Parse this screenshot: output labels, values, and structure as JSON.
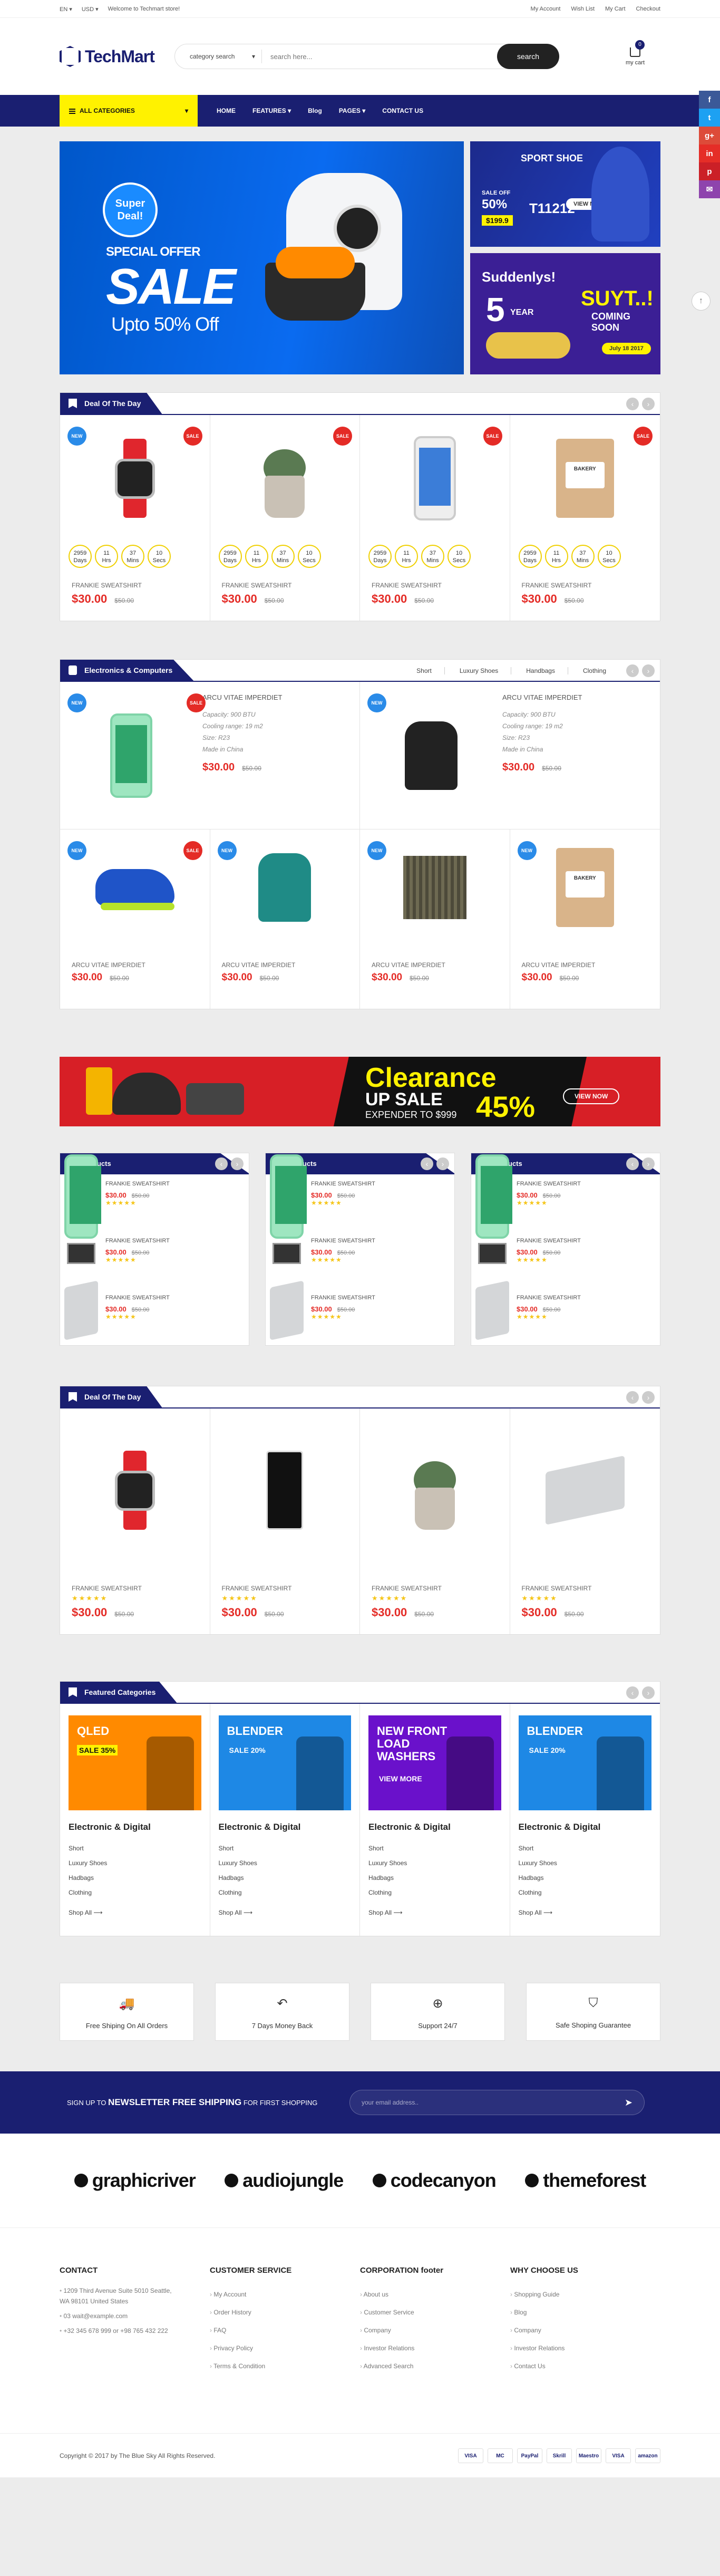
{
  "topbar": {
    "lang": "EN",
    "currency": "USD",
    "welcome": "Welcome to Techmart store!",
    "links": [
      "My Account",
      "Wish List",
      "My Cart",
      "Checkout"
    ]
  },
  "header": {
    "logo": "TechMart",
    "category_select": "category search",
    "search_placeholder": "search here...",
    "search_button": "search",
    "cart_label": "my cart",
    "cart_count": "0"
  },
  "nav": {
    "all_categories": "ALL CATEGORIES",
    "links": [
      "HOME",
      "FEATURES",
      "Blog",
      "PAGES",
      "CONTACT US"
    ]
  },
  "social": [
    {
      "icon": "facebook-icon",
      "glyph": "f",
      "color": "#3b5998"
    },
    {
      "icon": "twitter-icon",
      "glyph": "t",
      "color": "#1da1f2"
    },
    {
      "icon": "google-plus-icon",
      "glyph": "g+",
      "color": "#dd4b39"
    },
    {
      "icon": "linkedin-icon",
      "glyph": "in",
      "color": "#e52d27"
    },
    {
      "icon": "pinterest-icon",
      "glyph": "p",
      "color": "#cb2027"
    },
    {
      "icon": "email-icon",
      "glyph": "✉",
      "color": "#8e44ad"
    }
  ],
  "hero": {
    "badge": "Super Deal!",
    "special": "SPECIAL OFFER",
    "sale": "SALE",
    "upto": "Upto 50% Off",
    "side1": {
      "title": "SPORT SHOE",
      "sale_label": "SALE OFF",
      "pct": "50%",
      "price": "$199.9",
      "model": "T11212",
      "view": "VIEW NOW"
    },
    "side2": {
      "title": "Suddenlys!",
      "year": "YEAR",
      "big": "SUYT..!",
      "coming": "COMING SOON",
      "date": "July 18 2017"
    }
  },
  "deal1": {
    "title": "Deal Of The Day",
    "products": [
      {
        "img": "watch",
        "new": true,
        "sale": true,
        "name": "FRANKIE SWEATSHIRT",
        "price": "$30.00",
        "old": "$50.00",
        "countdown": [
          "2959",
          "11",
          "37",
          "10"
        ]
      },
      {
        "img": "plant",
        "new": false,
        "sale": true,
        "name": "FRANKIE SWEATSHIRT",
        "price": "$30.00",
        "old": "$50.00",
        "countdown": [
          "2959",
          "11",
          "37",
          "10"
        ]
      },
      {
        "img": "phone",
        "new": false,
        "sale": true,
        "name": "FRANKIE SWEATSHIRT",
        "price": "$30.00",
        "old": "$50.00",
        "countdown": [
          "2959",
          "11",
          "37",
          "10"
        ]
      },
      {
        "img": "bag",
        "new": false,
        "sale": true,
        "name": "FRANKIE SWEATSHIRT",
        "price": "$30.00",
        "old": "$50.00",
        "countdown": [
          "2959",
          "11",
          "37",
          "10"
        ]
      }
    ],
    "count_units": [
      "Days",
      "Hrs",
      "Mins",
      "Secs"
    ]
  },
  "electronics": {
    "title": "Electronics & Computers",
    "tabs": [
      "Short",
      "Luxury Shoes",
      "Handbags",
      "Clothing"
    ],
    "feature": [
      {
        "img": "phone-green",
        "name": "ARCU VITAE IMPERDIET",
        "specs": [
          "Capacity: 900 BTU",
          "Cooling range: 19 m2",
          "Size: R23",
          "Made in China"
        ],
        "price": "$30.00",
        "old": "$50.00"
      },
      {
        "img": "backpack",
        "name": "ARCU VITAE IMPERDIET",
        "specs": [
          "Capacity: 900 BTU",
          "Cooling range: 19 m2",
          "Size: R23",
          "Made in China"
        ],
        "price": "$30.00",
        "old": "$50.00"
      }
    ],
    "small": [
      {
        "img": "shoe",
        "new": true,
        "sale": true,
        "name": "ARCU VITAE IMPERDIET",
        "price": "$30.00",
        "old": "$50.00"
      },
      {
        "img": "backpack-teal",
        "new": true,
        "sale": false,
        "name": "ARCU VITAE IMPERDIET",
        "price": "$30.00",
        "old": "$50.00"
      },
      {
        "img": "scarf",
        "new": true,
        "sale": false,
        "name": "ARCU VITAE IMPERDIET",
        "price": "$30.00",
        "old": "$50.00"
      },
      {
        "img": "bag",
        "new": true,
        "sale": false,
        "name": "ARCU VITAE IMPERDIET",
        "price": "$30.00",
        "old": "$50.00"
      }
    ]
  },
  "clearance": {
    "t1": "Clearance",
    "t2": "UP SALE",
    "t3": "45%",
    "t4": "EXPENDER TO $999",
    "btn": "VIEW NOW"
  },
  "new_products": {
    "title": "New Products",
    "items": [
      {
        "img": "phone-green",
        "name": "FRANKIE SWEATSHIRT",
        "price": "$30.00",
        "old": "$50.00"
      },
      {
        "img": "monitor",
        "name": "FRANKIE SWEATSHIRT",
        "price": "$30.00",
        "old": "$50.00"
      },
      {
        "img": "laptop",
        "name": "FRANKIE SWEATSHIRT",
        "price": "$30.00",
        "old": "$50.00"
      }
    ]
  },
  "deal2": {
    "title": "Deal Of The Day",
    "products": [
      {
        "img": "watch",
        "name": "FRANKIE SWEATSHIRT",
        "price": "$30.00",
        "old": "$50.00"
      },
      {
        "img": "tvphone",
        "name": "FRANKIE SWEATSHIRT",
        "price": "$30.00",
        "old": "$50.00"
      },
      {
        "img": "plant",
        "name": "FRANKIE SWEATSHIRT",
        "price": "$30.00",
        "old": "$50.00"
      },
      {
        "img": "laptop",
        "name": "FRANKIE SWEATSHIRT",
        "price": "$30.00",
        "old": "$50.00"
      }
    ]
  },
  "featured": {
    "title": "Featured Categories",
    "cards": [
      {
        "banner": "QLED",
        "sub": "SALE 35%",
        "bg": "#ff8a00",
        "title": "Electronic & Digital",
        "links": [
          "Short",
          "Luxury Shoes",
          "Hadbags",
          "Clothing"
        ],
        "more": "Shop All ⟶"
      },
      {
        "banner": "BLENDER",
        "sub": "SALE 20%",
        "bg": "#1e88e5",
        "title": "Electronic & Digital",
        "links": [
          "Short",
          "Luxury Shoes",
          "Hadbags",
          "Clothing"
        ],
        "more": "Shop All ⟶"
      },
      {
        "banner": "NEW FRONT LOAD WASHERS",
        "sub": "VIEW MORE",
        "bg": "#6a11cb",
        "title": "Electronic & Digital",
        "links": [
          "Short",
          "Luxury Shoes",
          "Hadbags",
          "Clothing"
        ],
        "more": "Shop All ⟶"
      },
      {
        "banner": "BLENDER",
        "sub": "SALE 20%",
        "bg": "#1e88e5",
        "title": "Electronic & Digital",
        "links": [
          "Short",
          "Luxury Shoes",
          "Hadbags",
          "Clothing"
        ],
        "more": "Shop All ⟶"
      }
    ]
  },
  "services": [
    {
      "icon": "truck-icon",
      "glyph": "🚚",
      "text": "Free Shiping On All Orders"
    },
    {
      "icon": "return-icon",
      "glyph": "↶",
      "text": "7 Days Money Back"
    },
    {
      "icon": "lifebuoy-icon",
      "glyph": "⊕",
      "text": "Support 24/7"
    },
    {
      "icon": "shield-icon",
      "glyph": "⛉",
      "text": "Safe Shoping Guarantee"
    }
  ],
  "newsletter": {
    "pre": "SIGN UP TO",
    "bold": "NEWSLETTER FREE SHIPPING",
    "post": "FOR FIRST SHOPPING",
    "placeholder": "your email address.."
  },
  "brands": [
    "graphicriver",
    "audiojungle",
    "codecanyon",
    "themeforest"
  ],
  "footer": {
    "cols": [
      {
        "title": "CONTACT",
        "items": [
          "1209 Third Avenue Suite 5010 Seattle, WA 98101 United States",
          "03 wait@example.com",
          "+32 345 678 999 or +98 765 432 222"
        ]
      },
      {
        "title": "CUSTOMER SERVICE",
        "items": [
          "My Account",
          "Order History",
          "FAQ",
          "Privacy Policy",
          "Terms & Condition"
        ]
      },
      {
        "title": "CORPORATION footer",
        "items": [
          "About us",
          "Customer Service",
          "Company",
          "Investor Relations",
          "Advanced Search"
        ]
      },
      {
        "title": "WHY CHOOSE US",
        "items": [
          "Shopping Guide",
          "Blog",
          "Company",
          "Investor Relations",
          "Contact Us"
        ]
      }
    ],
    "copyright": "Copyright © 2017 by The Blue Sky All Rights Reserved.",
    "cards": [
      "VISA",
      "MC",
      "PayPal",
      "Skrill",
      "Maestro",
      "VISA",
      "amazon"
    ]
  }
}
